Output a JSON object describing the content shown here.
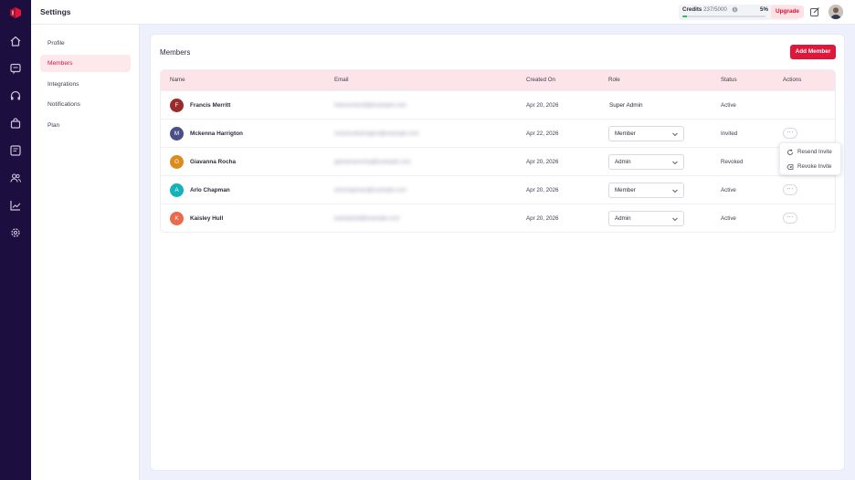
{
  "topbar": {
    "title": "Settings",
    "credits_label": "Credits",
    "credits_value": "237/5000",
    "credits_percent": "5%",
    "credits_fraction": 0.05,
    "upgrade_label": "Upgrade"
  },
  "settings_nav": {
    "items": [
      {
        "label": "Profile"
      },
      {
        "label": "Members"
      },
      {
        "label": "Integrations"
      },
      {
        "label": "Notifications"
      },
      {
        "label": "Plan"
      }
    ],
    "active": "Members"
  },
  "panel": {
    "title": "Members",
    "add_button_label": "Add Member"
  },
  "table": {
    "columns": [
      "Name",
      "Email",
      "Created On",
      "Role",
      "Status",
      "Actions"
    ],
    "rows": [
      {
        "initial": "F",
        "name": "Francis Merritt",
        "email": "francismerritt@example.com",
        "created": "Apr 20, 2026",
        "role": "Super Admin",
        "status": "Active",
        "avatar_color": "#9b2c2c"
      },
      {
        "initial": "M",
        "name": "Mckenna Harrigton",
        "email": "mckennaharrigton@example.com",
        "created": "Apr 22, 2026",
        "role": "Member",
        "status": "Invited",
        "avatar_color": "#4a4f8a"
      },
      {
        "initial": "G",
        "name": "Giavanna Rocha",
        "email": "giavannarocha@example.com",
        "created": "Apr 20, 2026",
        "role": "Admin",
        "status": "Revoked",
        "avatar_color": "#dd8b1f"
      },
      {
        "initial": "A",
        "name": "Arlo Chapman",
        "email": "arlochapman@example.com",
        "created": "Apr 20, 2026",
        "role": "Member",
        "status": "Active",
        "avatar_color": "#13b3b8"
      },
      {
        "initial": "K",
        "name": "Kaisley Hull",
        "email": "kaisleyhull@example.com",
        "created": "Apr 20, 2026",
        "role": "Admin",
        "status": "Active",
        "avatar_color": "#ea6a4e"
      }
    ]
  },
  "actions_menu": {
    "items": [
      {
        "label": "Resend Invite"
      },
      {
        "label": "Revoke Invite"
      }
    ]
  },
  "colors": {
    "accent": "#e0163b",
    "rail": "#1c0f3f",
    "table_header": "#fde4e8"
  }
}
